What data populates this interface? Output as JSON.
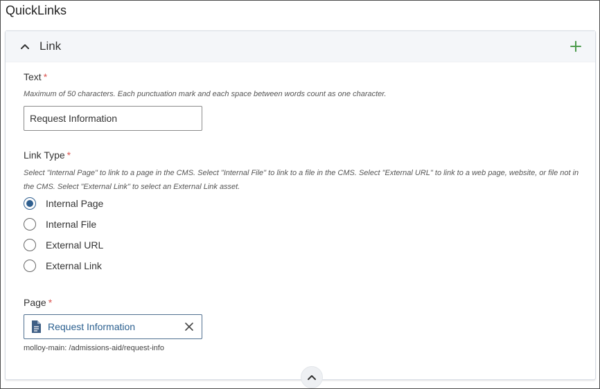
{
  "page_title": "QuickLinks",
  "panel": {
    "title": "Link",
    "collapse_icon": "chevron-up-icon",
    "add_icon": "plus-icon"
  },
  "text_field": {
    "label": "Text",
    "required_mark": "*",
    "help": "Maximum of 50 characters. Each punctuation mark and each space between words count as one character.",
    "value": "Request Information"
  },
  "link_type": {
    "label": "Link Type",
    "required_mark": "*",
    "help": "Select \"Internal Page\" to link to a page in the CMS. Select \"Internal File\" to link to a file in the CMS. Select \"External URL\" to link to a web page, website, or file not in the CMS. Select \"External Link\" to select an External Link asset.",
    "options": [
      {
        "label": "Internal Page",
        "checked": true
      },
      {
        "label": "Internal File",
        "checked": false
      },
      {
        "label": "External URL",
        "checked": false
      },
      {
        "label": "External Link",
        "checked": false
      }
    ]
  },
  "page_field": {
    "label": "Page",
    "required_mark": "*",
    "selected_page": "Request Information",
    "path": "molloy-main: /admissions-aid/request-info",
    "icons": {
      "document": "document-icon",
      "clear": "close-icon"
    }
  },
  "scroll_icon": "chevron-up-icon",
  "colors": {
    "accent": "#2f5f8f",
    "link": "#2a5f8f",
    "required": "#d9534f",
    "add": "#4a9a4a"
  }
}
